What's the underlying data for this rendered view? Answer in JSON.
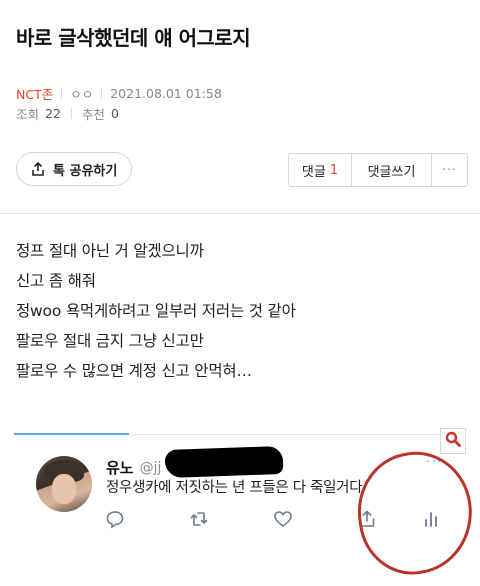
{
  "post": {
    "title": "바로 글삭했던데 얘 어그로지",
    "board": "NCT존",
    "author": "ㅇㅇ",
    "datetime": "2021.08.01 01:58",
    "views_label": "조회",
    "views": "22",
    "recommend_label": "추천",
    "recommend": "0"
  },
  "toolbar": {
    "share_label": "톡 공유하기",
    "comments_label": "댓글",
    "comments_count": "1",
    "write_comment_label": "댓글쓰기",
    "more_label": "···"
  },
  "body": {
    "lines": [
      "정프 절대 아닌 거 알겠으니까",
      "신고 좀 해줘",
      "정woo 욕먹게하려고 일부러 저러는 것 같아",
      "팔로우 절대 금지 그냥 신고만",
      "팔로우 수 많으면 계정 신고 안먹혀…"
    ]
  },
  "tweet": {
    "name": "유노",
    "handle": "@jj",
    "more": "···",
    "text": "정우생카에 저짓하는 년 프들은 다 죽일거다",
    "icons": [
      "reply-icon",
      "retweet-icon",
      "like-icon",
      "share-icon",
      "analytics-icon"
    ]
  },
  "colors": {
    "accent_red": "#e8452c",
    "twitter_blue": "#5aa9e6",
    "annotation_red": "#b8342a",
    "search_red": "#c8362a"
  }
}
